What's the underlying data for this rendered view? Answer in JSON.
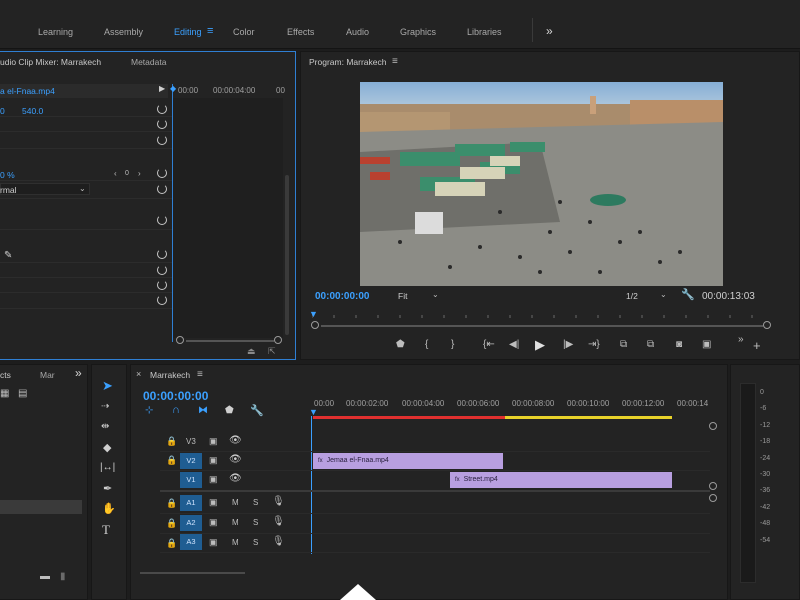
{
  "workspaces": [
    "Learning",
    "Assembly",
    "Editing",
    "Color",
    "Effects",
    "Audio",
    "Graphics",
    "Libraries"
  ],
  "workspace_active": "Editing",
  "more_workspaces": "»",
  "source_panel": {
    "tab_mixer": "udio Clip Mixer: Marrakech",
    "tab_metadata": "Metadata",
    "clip_name": "a el-Fnaa.mp4",
    "ruler_start": "00:00",
    "ruler_mid": "00:00:04:00",
    "ruler_end": "00",
    "pos_x": "0",
    "pos_y": "540.0",
    "percent": "0 %",
    "stepper_value": "0",
    "blend_mode": "rmal"
  },
  "program_monitor": {
    "title": "Program: Marrakech",
    "timecode_current": "00:00:00:00",
    "fit": "Fit",
    "resolution": "1/2",
    "timecode_duration": "00:00:13:03"
  },
  "project_panel": {
    "tab_effects": "cts",
    "tab_marker": "Mar",
    "more": "»"
  },
  "timeline": {
    "sequence": "Marrakech",
    "timecode": "00:00:00:00",
    "ruler": [
      "00:00",
      "00:00:02:00",
      "00:00:04:00",
      "00:00:06:00",
      "00:00:08:00",
      "00:00:10:00",
      "00:00:12:00",
      "00:00:14"
    ],
    "video_tracks": [
      {
        "label": "V3",
        "active_label": ""
      },
      {
        "label": "V2",
        "active_label": "V2"
      },
      {
        "label": "V1",
        "active_label": "V1"
      }
    ],
    "audio_tracks": [
      {
        "label": "A1",
        "m": "M",
        "s": "S"
      },
      {
        "label": "A2",
        "m": "M",
        "s": "S"
      },
      {
        "label": "A3",
        "m": "M",
        "s": "S"
      }
    ],
    "clips": [
      {
        "name": "Jemaa el-Fnaa.mp4"
      },
      {
        "name": "Street.mp4"
      }
    ]
  },
  "audio_meter": [
    "0",
    "-6",
    "-12",
    "-18",
    "-24",
    "-30",
    "-36",
    "-42",
    "-48",
    "-54"
  ],
  "colors": {
    "accent": "#3ba0ff",
    "clip": "#b89fe0",
    "track_active": "#1f5d92",
    "render_red": "#e0302f",
    "render_yellow": "#e8d22a"
  }
}
